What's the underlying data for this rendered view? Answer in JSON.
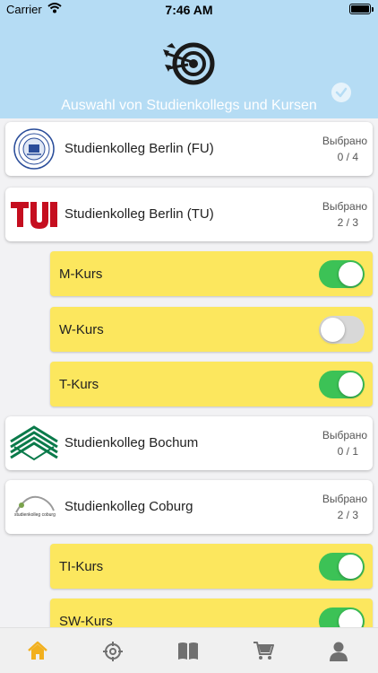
{
  "status_bar": {
    "carrier": "Carrier",
    "time": "7:46 AM"
  },
  "header": {
    "title": "Auswahl von Studienkollegs und Kursen",
    "logo_icon": "target-arrows-icon",
    "check_icon": "check-circle-icon"
  },
  "colors": {
    "header_bg": "#b5dcf4",
    "course_bg": "#fce75e",
    "toggle_on": "#3cc256",
    "toggle_off": "#d8d8d8",
    "tab_active": "#f2b01e",
    "tab_inactive": "#707070"
  },
  "kollegs": [
    {
      "name": "Studienkolleg Berlin (FU)",
      "selected_label": "Выбрано",
      "count": "0 / 4",
      "logo": "fu-berlin-seal"
    },
    {
      "name": "Studienkolleg Berlin (TU)",
      "selected_label": "Выбрано",
      "count": "2 / 3",
      "logo": "tu-berlin-logo"
    },
    {
      "name": "Studienkolleg Bochum",
      "selected_label": "Выбрано",
      "count": "0 / 1",
      "logo": "bochum-logo"
    },
    {
      "name": "Studienkolleg Coburg",
      "selected_label": "Выбрано",
      "count": "2 / 3",
      "logo": "coburg-logo",
      "logo_text": "studienkolleg coburg"
    }
  ],
  "courses": [
    {
      "label": "M-Kurs",
      "enabled": true
    },
    {
      "label": "W-Kurs",
      "enabled": false
    },
    {
      "label": "T-Kurs",
      "enabled": true
    },
    {
      "label": "TI-Kurs",
      "enabled": true
    },
    {
      "label": "SW-Kurs",
      "enabled": true
    }
  ],
  "tabbar": {
    "items": [
      {
        "icon": "home-icon",
        "active": true
      },
      {
        "icon": "target-icon",
        "active": false
      },
      {
        "icon": "book-icon",
        "active": false
      },
      {
        "icon": "cart-icon",
        "active": false
      },
      {
        "icon": "user-icon",
        "active": false
      }
    ]
  }
}
